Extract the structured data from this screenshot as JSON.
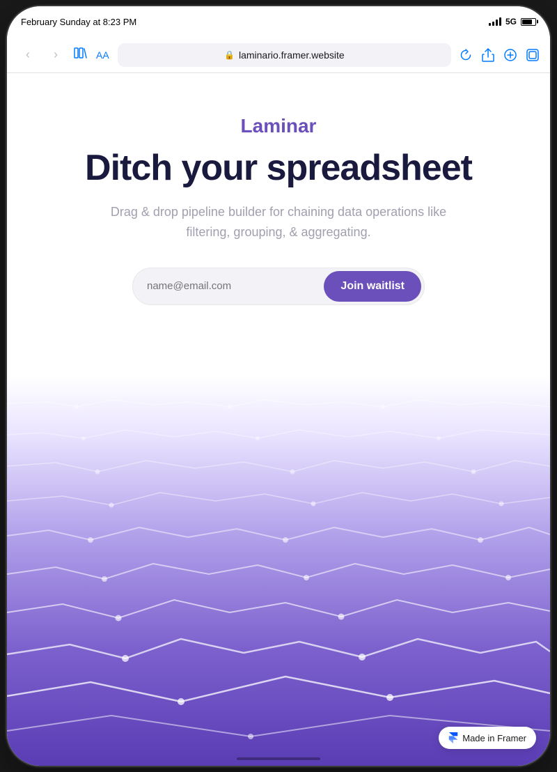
{
  "status_bar": {
    "time": "February Sunday at 8:23 PM",
    "network": "5G"
  },
  "browser": {
    "url": "laminario.framer.website",
    "aa_label": "AA",
    "back_disabled": true,
    "forward_disabled": true
  },
  "hero": {
    "brand": "Laminar",
    "title": "Ditch your spreadsheet",
    "subtitle": "Drag & drop pipeline builder for chaining data operations like filtering, grouping, & aggregating.",
    "email_placeholder": "name@email.com",
    "cta_label": "Join waitlist"
  },
  "badge": {
    "label": "Made in Framer"
  },
  "colors": {
    "brand_purple": "#6b4fbb",
    "title_dark": "#1a1a3e",
    "subtitle_gray": "#a0a0b0",
    "wave_start": "#e8e2ff",
    "wave_end": "#7c5cbf"
  }
}
